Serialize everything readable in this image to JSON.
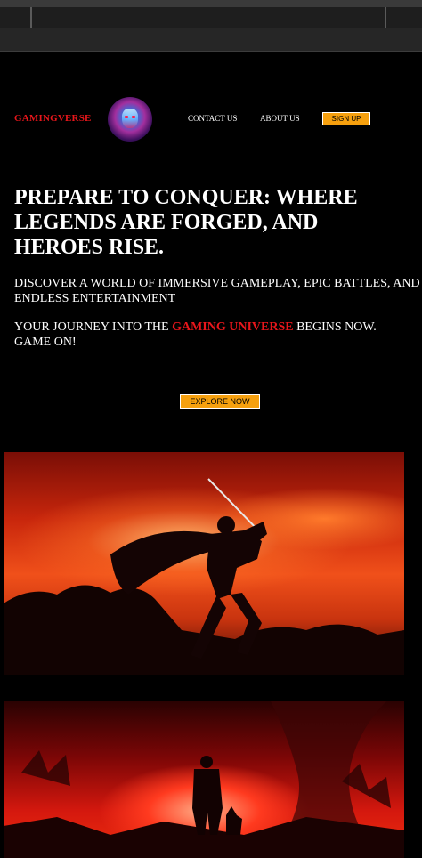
{
  "nav": {
    "brand": "GAMINGVERSE",
    "links": [
      "CONTACT US",
      "ABOUT US"
    ],
    "signup_label": "SIGN UP"
  },
  "hero": {
    "headline": "PREPARE TO CONQUER: WHERE LEGENDS ARE FORGED, AND HEROES RISE.",
    "sub1": "DISCOVER A WORLD OF IMMERSIVE GAMEPLAY, EPIC BATTLES, AND ENDLESS ENTERTAINMENT",
    "sub2_before": "YOUR JOURNEY INTO THE ",
    "sub2_highlight": "GAMING UNIVERSE",
    "sub2_after": " BEGINS NOW. GAME ON!",
    "cta_label": "EXPLORE NOW"
  },
  "colors": {
    "accent_red": "#e8161b",
    "button_orange": "#f6a00e",
    "background": "#000000"
  },
  "images": [
    "samurai-warrior-art",
    "dark-warrior-wolf-art"
  ]
}
